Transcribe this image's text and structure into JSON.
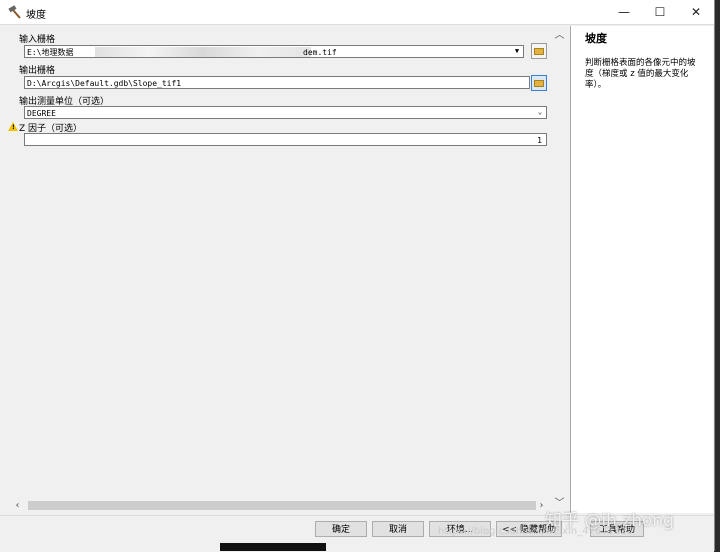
{
  "window": {
    "title": "坡度",
    "minimize": "—",
    "maximize": "☐",
    "close": "✕"
  },
  "form": {
    "input_raster": {
      "label": "输入栅格",
      "value_prefix": "E:\\地理数据",
      "value_suffix": "dem.tif"
    },
    "output_raster": {
      "label": "输出栅格",
      "value": "D:\\Arcgis\\Default.gdb\\Slope_tif1"
    },
    "measure_unit": {
      "label": "输出测量单位（可选）",
      "value": "DEGREE"
    },
    "z_factor": {
      "label": "Z 因子（可选）",
      "value": "1"
    }
  },
  "help": {
    "title": "坡度",
    "text": "判断栅格表面的各像元中的坡度（梯度或 z 值的最大变化率）。"
  },
  "buttons": {
    "ok": "确定",
    "cancel": "取消",
    "environments": "环境...",
    "hide_help": "<< 隐藏帮助",
    "tool_help": "工具帮助"
  },
  "watermark": {
    "main": "知乎 @ih.zhong",
    "sub": "https://blog.csdn.net/weixin_47671325"
  },
  "icons": [
    "hammer-icon",
    "folder-icon",
    "warning-icon",
    "chevron-down-icon",
    "chevron-up-icon",
    "chevron-left-icon",
    "chevron-right-icon"
  ]
}
